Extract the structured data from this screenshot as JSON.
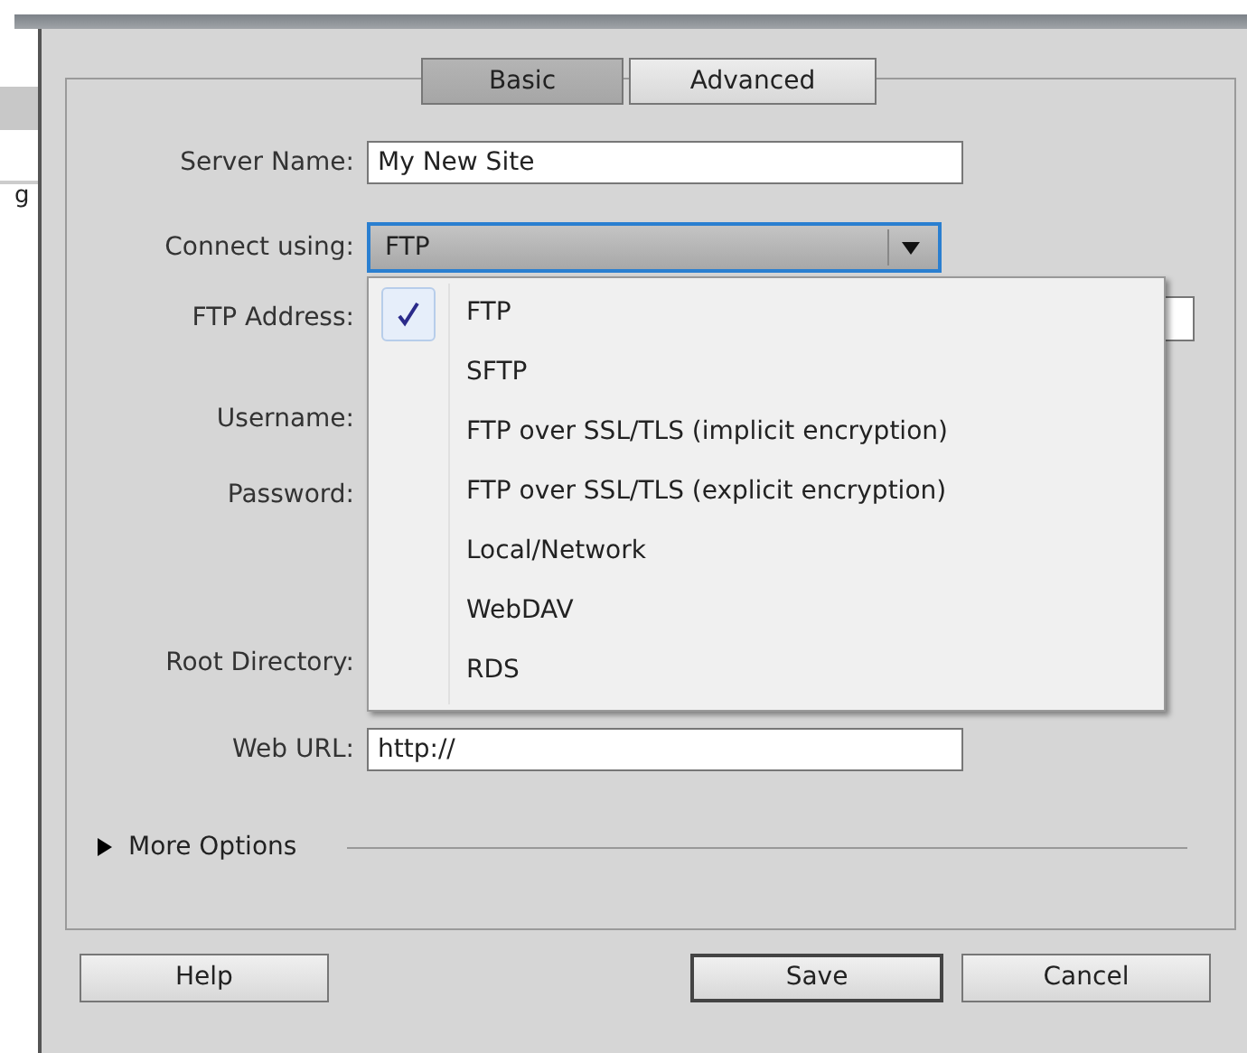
{
  "left_panel": {
    "text": "g"
  },
  "tabs": [
    {
      "label": "Basic",
      "selected": true
    },
    {
      "label": "Advanced",
      "selected": false
    }
  ],
  "fields": [
    {
      "kind": "text",
      "label": "Server Name:",
      "value": "My New Site"
    },
    {
      "kind": "select",
      "label": "Connect using:",
      "value": "FTP",
      "expanded": true
    },
    {
      "kind": "covered",
      "label": "FTP Address:"
    },
    {
      "kind": "label",
      "label": "Username:"
    },
    {
      "kind": "label",
      "label": "Password:"
    },
    {
      "kind": "label",
      "label": "Root Directory:"
    },
    {
      "kind": "text",
      "label": "Web URL:",
      "value": "http://"
    }
  ],
  "dropdown_options": [
    {
      "label": "FTP",
      "selected": true
    },
    {
      "label": "SFTP",
      "selected": false
    },
    {
      "label": "FTP over SSL/TLS (implicit encryption)",
      "selected": false
    },
    {
      "label": "FTP over SSL/TLS (explicit encryption)",
      "selected": false
    },
    {
      "label": "Local/Network",
      "selected": false
    },
    {
      "label": "WebDAV",
      "selected": false
    },
    {
      "label": "RDS",
      "selected": false
    }
  ],
  "more_options": {
    "label": "More Options",
    "expanded": false
  },
  "buttons": [
    {
      "label": "Help",
      "kind": "normal"
    },
    {
      "label": "Save",
      "kind": "default"
    },
    {
      "label": "Cancel",
      "kind": "normal"
    }
  ]
}
